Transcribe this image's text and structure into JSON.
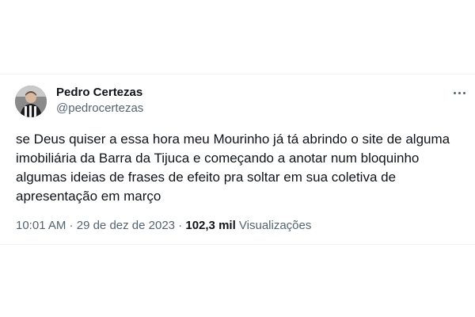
{
  "tweet": {
    "author": {
      "name": "Pedro Certezas",
      "handle": "@pedrocertezas"
    },
    "text": "se Deus quiser a essa hora meu Mourinho já tá abrindo o site de alguma imobiliária da Barra da Tijuca e começando a anotar num bloquinho algumas ideias de frases de efeito pra soltar em sua coletiva de apresentação em março",
    "time": "10:01 AM",
    "separator": " · ",
    "date": "29 de dez de 2023",
    "views_count": "102,3 mil",
    "views_label": "Visualizações",
    "more_icon": "ellipsis-icon"
  }
}
